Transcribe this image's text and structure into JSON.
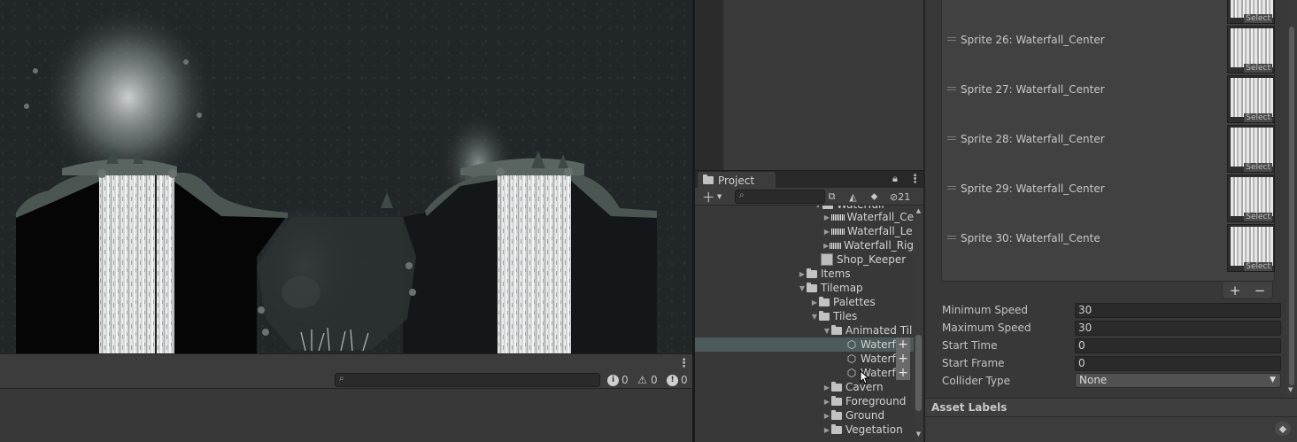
{
  "console": {
    "info_count": "0",
    "warning_count": "0",
    "error_count": "0"
  },
  "project": {
    "tab_label": "Project",
    "hidden_count": "21",
    "tree": [
      {
        "label": "Waterfall_Ce",
        "icon": "sprite-icon"
      },
      {
        "label": "Waterfall_Le",
        "icon": "sprite-icon"
      },
      {
        "label": "Waterfall_Rig",
        "icon": "sprite-icon"
      },
      {
        "label": "Shop_Keeper",
        "icon": "image-icon"
      },
      {
        "label": "Items",
        "icon": "folder-icon"
      },
      {
        "label": "Tilemap",
        "icon": "folder-icon"
      },
      {
        "label": "Palettes",
        "icon": "folder-icon"
      },
      {
        "label": "Tiles",
        "icon": "folder-icon"
      },
      {
        "label": "Animated Til",
        "icon": "folder-icon"
      },
      {
        "label": "Waterf",
        "icon": "tile-asset-icon"
      },
      {
        "label": "Waterf",
        "icon": "tile-asset-icon"
      },
      {
        "label": "Waterf",
        "icon": "tile-asset-icon"
      },
      {
        "label": "Cavern",
        "icon": "folder-icon"
      },
      {
        "label": "Foreground",
        "icon": "folder-icon"
      },
      {
        "label": "Ground",
        "icon": "folder-icon"
      },
      {
        "label": "Vegetation",
        "icon": "folder-icon"
      }
    ]
  },
  "inspector": {
    "sprites": [
      {
        "label": "Sprite 26: Waterfall_Center",
        "select": "Select"
      },
      {
        "label": "Sprite 27: Waterfall_Center",
        "select": "Select"
      },
      {
        "label": "Sprite 28: Waterfall_Center",
        "select": "Select"
      },
      {
        "label": "Sprite 29: Waterfall_Center",
        "select": "Select"
      },
      {
        "label": "Sprite 30: Waterfall_Cente",
        "select": "Select"
      }
    ],
    "top_select": "Select",
    "add_label": "+",
    "remove_label": "−",
    "fields": {
      "min_speed_label": "Minimum Speed",
      "min_speed": "30",
      "max_speed_label": "Maximum Speed",
      "max_speed": "30",
      "start_time_label": "Start Time",
      "start_time": "0",
      "start_frame_label": "Start Frame",
      "start_frame": "0",
      "collider_type_label": "Collider Type",
      "collider_type": "None"
    },
    "asset_labels_title": "Asset Labels"
  }
}
